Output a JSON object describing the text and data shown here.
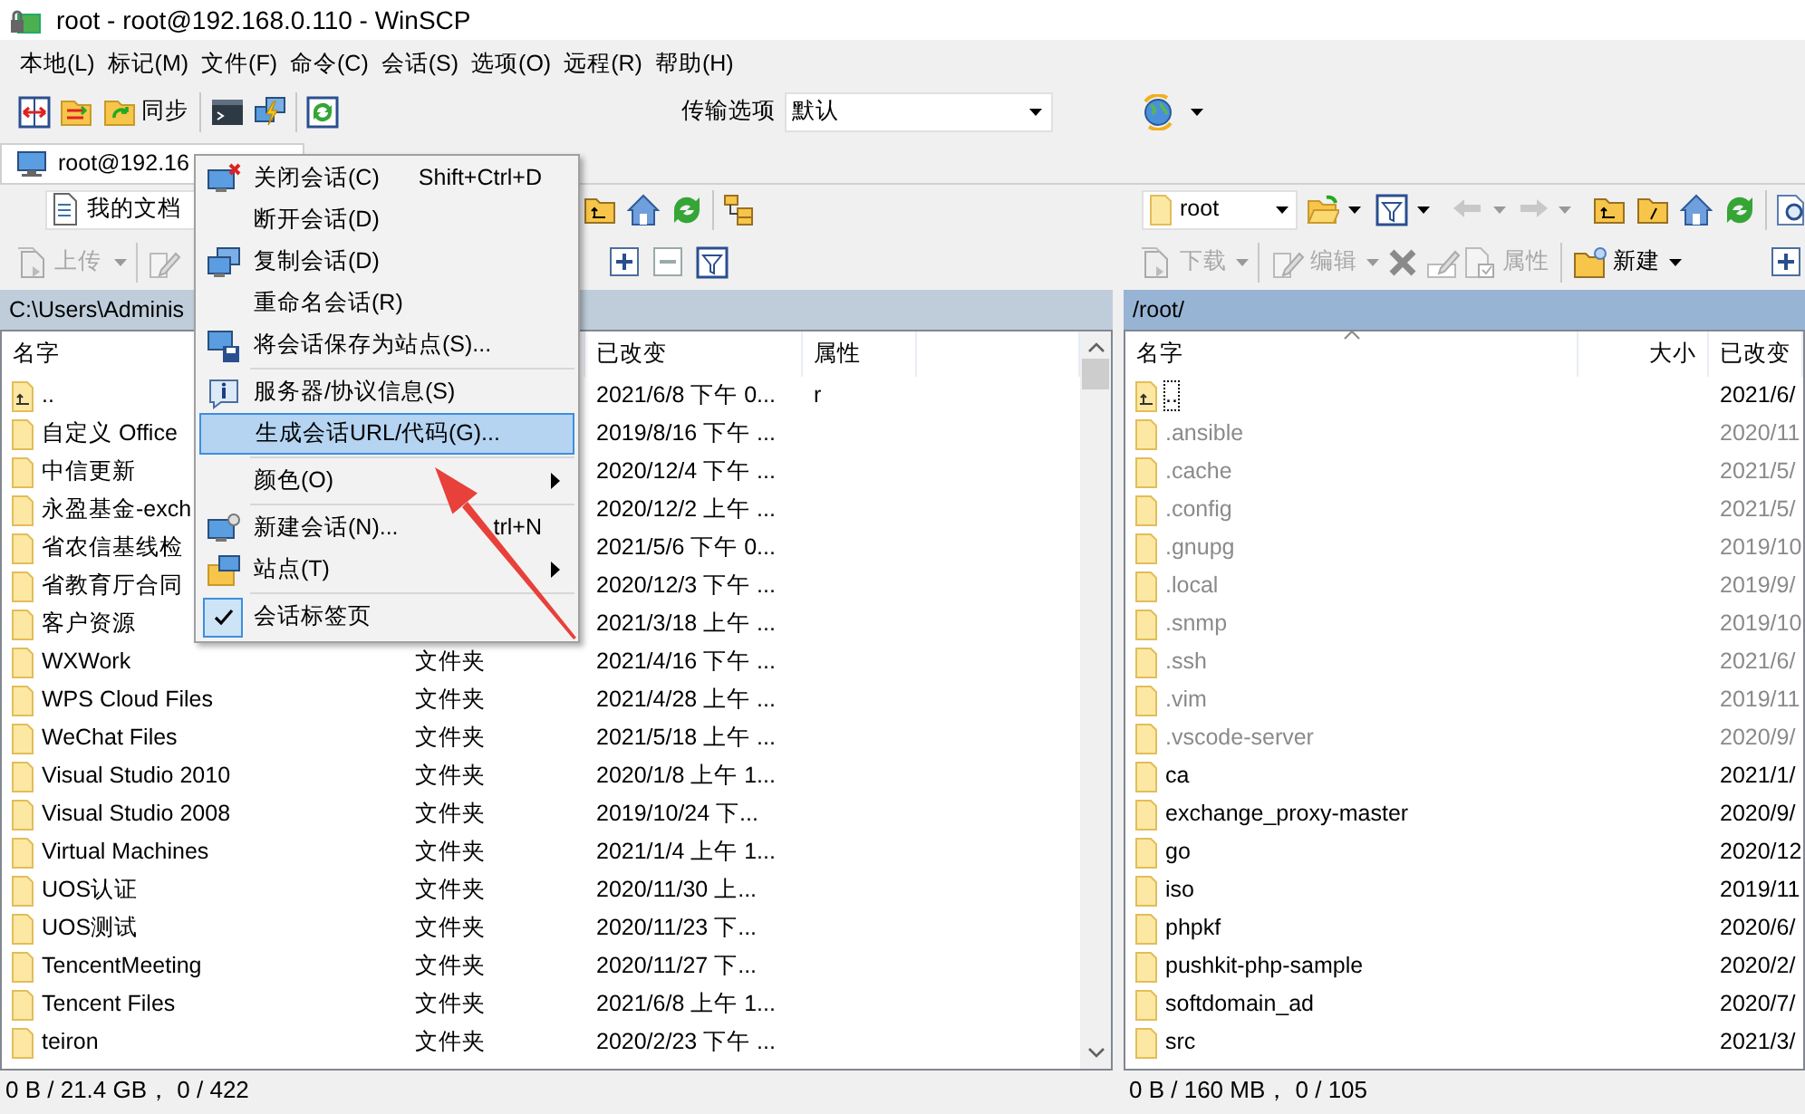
{
  "window": {
    "title": "root - root@192.168.0.110 - WinSCP"
  },
  "menu_bar": [
    "本地(L)",
    "标记(M)",
    "文件(F)",
    "命令(C)",
    "会话(S)",
    "选项(O)",
    "远程(R)",
    "帮助(H)"
  ],
  "toolbar": {
    "sync_label": "同步",
    "transfer_label": "传输选项",
    "transfer_value": "默认"
  },
  "tabs": [
    {
      "label": "root@192.16",
      "selected": true
    }
  ],
  "local": {
    "location": "我的文档",
    "upload": {
      "label": "上传",
      "disabled": true
    },
    "path": "C:\\Users\\Adminis",
    "columns": [
      {
        "label": "名字"
      },
      {
        "label": "已改变"
      },
      {
        "label": "属性"
      }
    ],
    "rows": [
      {
        "kind": "parent",
        "name": "..",
        "modified": "2021/6/8 下午 0...",
        "attributes": "r"
      },
      {
        "kind": "folder",
        "name": "自定义 Office",
        "modified": "2019/8/16 下午 ..."
      },
      {
        "kind": "folder",
        "name": "中信更新",
        "modified": "2020/12/4 下午 ..."
      },
      {
        "kind": "folder",
        "name": "永盈基金-exch",
        "modified": "2020/12/2 上午 ..."
      },
      {
        "kind": "folder",
        "name": "省农信基线检",
        "modified": "2021/5/6 下午 0..."
      },
      {
        "kind": "folder",
        "name": "省教育厅合同",
        "modified": "2020/12/3 下午 ..."
      },
      {
        "kind": "folder",
        "name": "客户资源",
        "modified": "2021/3/18 上午 ..."
      },
      {
        "kind": "folder",
        "name": "WXWork",
        "type": "文件夹",
        "modified": "2021/4/16 下午 ..."
      },
      {
        "kind": "folder",
        "name": "WPS Cloud Files",
        "type": "文件夹",
        "modified": "2021/4/28 上午 ..."
      },
      {
        "kind": "folder",
        "name": "WeChat Files",
        "type": "文件夹",
        "modified": "2021/5/18 上午 ..."
      },
      {
        "kind": "folder",
        "name": "Visual Studio 2010",
        "type": "文件夹",
        "modified": "2020/1/8 上午 1..."
      },
      {
        "kind": "folder",
        "name": "Visual Studio 2008",
        "type": "文件夹",
        "modified": "2019/10/24 下..."
      },
      {
        "kind": "folder",
        "name": "Virtual Machines",
        "type": "文件夹",
        "modified": "2021/1/4 上午 1..."
      },
      {
        "kind": "folder",
        "name": "UOS认证",
        "type": "文件夹",
        "modified": "2020/11/30 上..."
      },
      {
        "kind": "folder",
        "name": "UOS测试",
        "type": "文件夹",
        "modified": "2020/11/23 下..."
      },
      {
        "kind": "folder",
        "name": "TencentMeeting",
        "type": "文件夹",
        "modified": "2020/11/27 下..."
      },
      {
        "kind": "folder",
        "name": "Tencent Files",
        "type": "文件夹",
        "modified": "2021/6/8 上午 1..."
      },
      {
        "kind": "folder",
        "name": "teiron",
        "type": "文件夹",
        "modified": "2020/2/23 下午 ..."
      }
    ],
    "status": "0 B / 21.4 GB， 0 / 422"
  },
  "remote": {
    "location": "root",
    "path": "/root/",
    "buttons": [
      {
        "kind": "download",
        "label": "下载",
        "disabled": true
      },
      {
        "kind": "edit",
        "label": "编辑",
        "disabled": true
      },
      {
        "kind": "properties",
        "label": "属性",
        "disabled": true
      },
      {
        "kind": "new",
        "label": "新建",
        "disabled": false
      }
    ],
    "columns": [
      {
        "label": "名字",
        "sorted": true
      },
      {
        "label": "大小",
        "sorted": false
      },
      {
        "label": "已改变",
        "sorted": false
      }
    ],
    "rows": [
      {
        "kind": "parent",
        "name": "..",
        "modified": "2021/6/",
        "hidden": false,
        "focused": true
      },
      {
        "kind": "folder",
        "name": ".ansible",
        "modified": "2020/11",
        "hidden": true,
        "focused": false
      },
      {
        "kind": "folder",
        "name": ".cache",
        "modified": "2021/5/",
        "hidden": true,
        "focused": false
      },
      {
        "kind": "folder",
        "name": ".config",
        "modified": "2021/5/",
        "hidden": true,
        "focused": false
      },
      {
        "kind": "folder",
        "name": ".gnupg",
        "modified": "2019/10",
        "hidden": true,
        "focused": false
      },
      {
        "kind": "folder",
        "name": ".local",
        "modified": "2019/9/",
        "hidden": true,
        "focused": false
      },
      {
        "kind": "folder",
        "name": ".snmp",
        "modified": "2019/10",
        "hidden": true,
        "focused": false
      },
      {
        "kind": "folder",
        "name": ".ssh",
        "modified": "2021/6/",
        "hidden": true,
        "focused": false
      },
      {
        "kind": "folder",
        "name": ".vim",
        "modified": "2019/11",
        "hidden": true,
        "focused": false
      },
      {
        "kind": "folder",
        "name": ".vscode-server",
        "modified": "2020/9/",
        "hidden": true,
        "focused": false
      },
      {
        "kind": "folder",
        "name": "ca",
        "modified": "2021/1/",
        "hidden": false,
        "focused": false
      },
      {
        "kind": "folder",
        "name": "exchange_proxy-master",
        "modified": "2020/9/",
        "hidden": false,
        "focused": false
      },
      {
        "kind": "folder",
        "name": "go",
        "modified": "2020/12",
        "hidden": false,
        "focused": false
      },
      {
        "kind": "folder",
        "name": "iso",
        "modified": "2019/11",
        "hidden": false,
        "focused": false
      },
      {
        "kind": "folder",
        "name": "phpkf",
        "modified": "2020/6/",
        "hidden": false,
        "focused": false
      },
      {
        "kind": "folder",
        "name": "pushkit-php-sample",
        "modified": "2020/2/",
        "hidden": false,
        "focused": false
      },
      {
        "kind": "folder",
        "name": "softdomain_ad",
        "modified": "2020/7/",
        "hidden": false,
        "focused": false
      },
      {
        "kind": "folder",
        "name": "src",
        "modified": "2021/3/",
        "hidden": false,
        "focused": false
      }
    ],
    "status": "0 B / 160 MB， 0 / 105"
  },
  "context_menu": [
    {
      "kind": "item",
      "label": "关闭会话(C)",
      "shortcut": "Shift+Ctrl+D",
      "selected": false,
      "checked": false,
      "submenu": false
    },
    {
      "kind": "item",
      "label": "断开会话(D)",
      "selected": false,
      "checked": false,
      "submenu": false
    },
    {
      "kind": "item",
      "label": "复制会话(D)",
      "selected": false,
      "checked": false,
      "submenu": false
    },
    {
      "kind": "item",
      "label": "重命名会话(R)",
      "selected": false,
      "checked": false,
      "submenu": false
    },
    {
      "kind": "item",
      "label": "将会话保存为站点(S)...",
      "selected": false,
      "checked": false,
      "submenu": false
    },
    {
      "kind": "separator"
    },
    {
      "kind": "item",
      "label": "服务器/协议信息(S)",
      "selected": false,
      "checked": false,
      "submenu": false
    },
    {
      "kind": "item",
      "label": "生成会话URL/代码(G)...",
      "selected": true,
      "checked": false,
      "submenu": false
    },
    {
      "kind": "separator"
    },
    {
      "kind": "item",
      "label": "颜色(O)",
      "selected": false,
      "checked": false,
      "submenu": true
    },
    {
      "kind": "separator"
    },
    {
      "kind": "item",
      "label": "新建会话(N)...",
      "shortcut": "trl+N",
      "selected": false,
      "checked": false,
      "submenu": false
    },
    {
      "kind": "item",
      "label": "站点(T)",
      "selected": false,
      "checked": false,
      "submenu": true
    },
    {
      "kind": "separator"
    },
    {
      "kind": "item",
      "label": "会话标签页",
      "selected": false,
      "checked": true,
      "submenu": false
    }
  ]
}
